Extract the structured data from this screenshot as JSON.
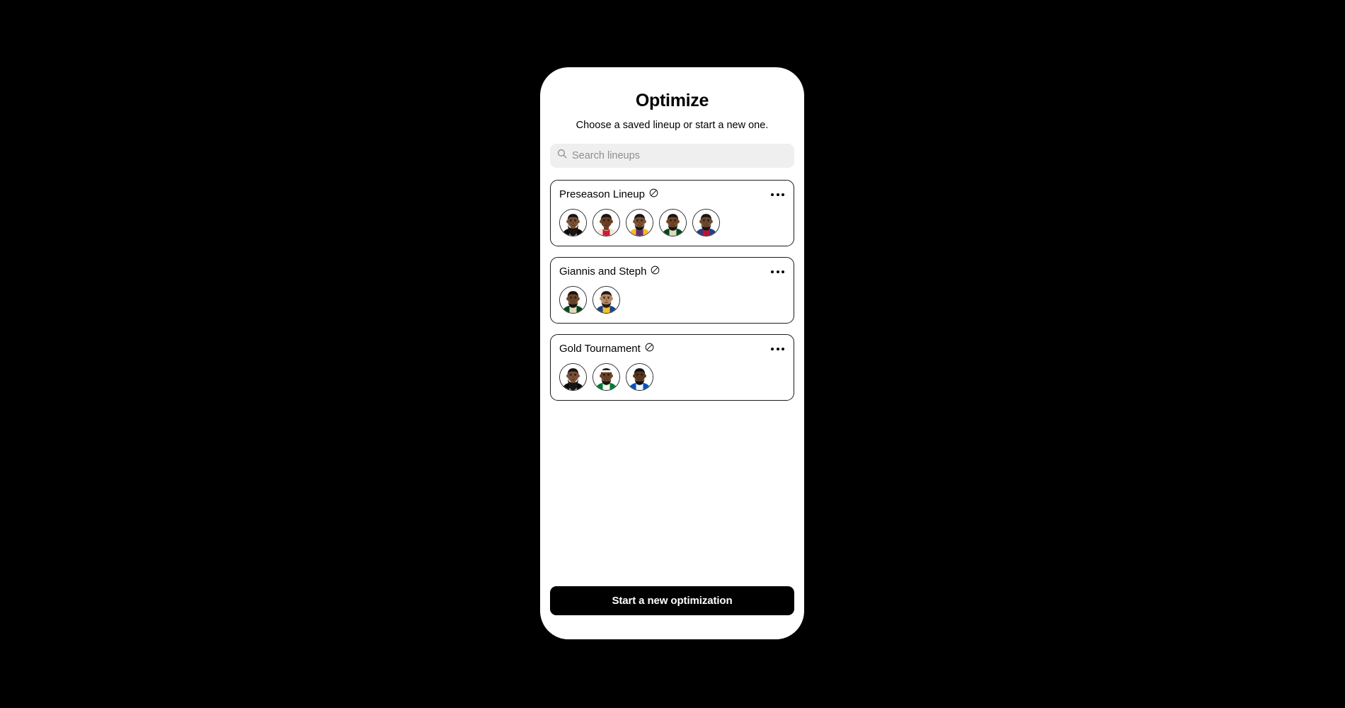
{
  "app": {
    "title": "Optimize",
    "subtitle": "Choose a saved lineup or start a new one.",
    "background_color": "#000000",
    "screen_color": "#ffffff",
    "accent_color": "#000000"
  },
  "search": {
    "placeholder": "Search lineups",
    "value": "",
    "icon": "search-icon",
    "background_color": "#efefef"
  },
  "lineups": [
    {
      "name": "Preseason Lineup",
      "status_icon": "circle-slash-icon",
      "menu_icon": "more-options-icon",
      "players": [
        {
          "jersey_primary": "#0b0b0b",
          "jersey_secondary": "#ffffff",
          "skin": "#7a5038",
          "hair": "#1a1411",
          "beard": true,
          "beard_size": "large",
          "headband": false
        },
        {
          "jersey_primary": "#f2e9d8",
          "jersey_secondary": "#c8102e",
          "skin": "#6b4126",
          "hair": "#1a1411",
          "beard": false,
          "beard_size": "none",
          "headband": false
        },
        {
          "jersey_primary": "#fdb927",
          "jersey_secondary": "#552583",
          "skin": "#7a5038",
          "hair": "#1a1411",
          "beard": true,
          "beard_size": "small",
          "headband": false
        },
        {
          "jersey_primary": "#00471b",
          "jersey_secondary": "#eee1c6",
          "skin": "#6f4627",
          "hair": "#1a1411",
          "beard": true,
          "beard_size": "small",
          "headband": false
        },
        {
          "jersey_primary": "#1d428a",
          "jersey_secondary": "#c8102e",
          "skin": "#6b4a33",
          "hair": "#1a1411",
          "beard": true,
          "beard_size": "small",
          "headband": false
        }
      ]
    },
    {
      "name": "Giannis and Steph",
      "status_icon": "circle-slash-icon",
      "menu_icon": "more-options-icon",
      "players": [
        {
          "jersey_primary": "#00471b",
          "jersey_secondary": "#eee1c6",
          "skin": "#6f4627",
          "hair": "#1a1411",
          "beard": true,
          "beard_size": "small",
          "headband": false
        },
        {
          "jersey_primary": "#1d428a",
          "jersey_secondary": "#ffc72c",
          "skin": "#b98964",
          "hair": "#241a14",
          "beard": true,
          "beard_size": "small",
          "headband": false
        }
      ]
    },
    {
      "name": "Gold Tournament",
      "status_icon": "circle-slash-icon",
      "menu_icon": "more-options-icon",
      "players": [
        {
          "jersey_primary": "#0b0b0b",
          "jersey_secondary": "#ffffff",
          "skin": "#7a5038",
          "hair": "#1a1411",
          "beard": true,
          "beard_size": "large",
          "headband": false
        },
        {
          "jersey_primary": "#007a33",
          "jersey_secondary": "#ffffff",
          "skin": "#6b4126",
          "hair": "#1a1411",
          "beard": true,
          "beard_size": "small",
          "headband": true
        },
        {
          "jersey_primary": "#0053bc",
          "jersey_secondary": "#ffffff",
          "skin": "#5a3620",
          "hair": "#130f0c",
          "beard": true,
          "beard_size": "small",
          "headband": false
        }
      ]
    }
  ],
  "footer": {
    "cta_label": "Start a new optimization"
  }
}
